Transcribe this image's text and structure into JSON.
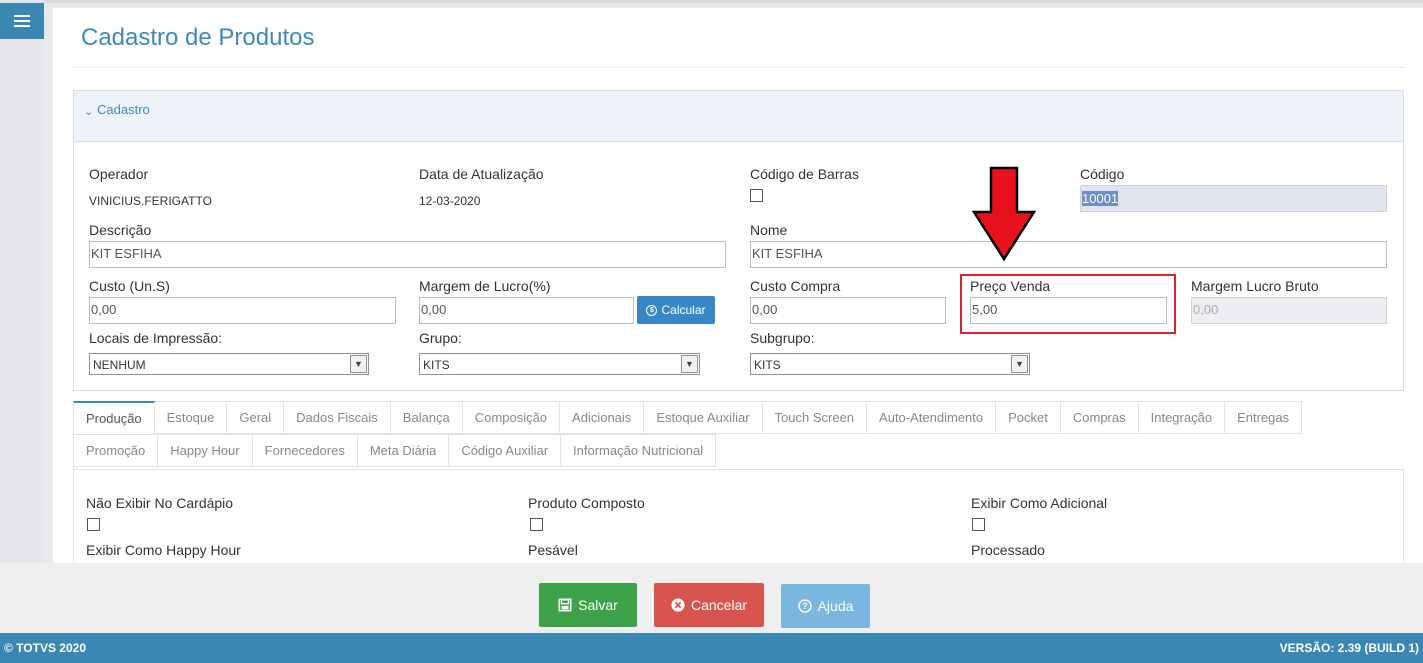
{
  "page_title": "Cadastro de Produtos",
  "panel": {
    "title": "Cadastro"
  },
  "fields": {
    "operador": {
      "label": "Operador",
      "value": "VINICIUS.FERIGATTO"
    },
    "data_atualizacao": {
      "label": "Data de Atualização",
      "value": "12-03-2020"
    },
    "codigo_barras": {
      "label": "Código de Barras",
      "checked": false
    },
    "codigo": {
      "label": "Código",
      "value": "10001"
    },
    "descricao": {
      "label": "Descrição",
      "value": "KIT ESFIHA"
    },
    "nome": {
      "label": "Nome",
      "value": "KIT ESFIHA"
    },
    "custo_un": {
      "label": "Custo (Un.S)",
      "value": "0,00"
    },
    "margem_lucro": {
      "label": "Margem de Lucro(%)",
      "value": "0,00"
    },
    "custo_compra": {
      "label": "Custo Compra",
      "value": "0,00"
    },
    "preco_venda": {
      "label": "Preço Venda",
      "value": "5,00"
    },
    "margem_lucro_bruto": {
      "label": "Margem Lucro Bruto",
      "value": "0,00"
    },
    "locais_impressao": {
      "label": "Locais de Impressão:",
      "selected": "NENHUM"
    },
    "grupo": {
      "label": "Grupo:",
      "selected": "KITS"
    },
    "subgrupo": {
      "label": "Subgrupo:",
      "selected": "KITS"
    }
  },
  "calc_button": {
    "label": "Calcular",
    "icon": "dollar-icon"
  },
  "tabs_row1": [
    "Produção",
    "Estoque",
    "Geral",
    "Dados Fiscais",
    "Balança",
    "Composição",
    "Adicionais",
    "Estoque Auxiliar",
    "Touch Screen",
    "Auto-Atendimento",
    "Pocket",
    "Compras",
    "Integração",
    "Entregas"
  ],
  "tabs_row2": [
    "Promoção",
    "Happy Hour",
    "Fornecedores",
    "Meta Diária",
    "Código Auxiliar",
    "Informação Nutricional"
  ],
  "active_tab": "Produção",
  "producao": {
    "nao_exibir_cardapio": {
      "label": "Não Exibir No Cardápio",
      "checked": false
    },
    "produto_composto": {
      "label": "Produto Composto",
      "checked": false
    },
    "exibir_adicional": {
      "label": "Exibir Como Adicional",
      "checked": false
    },
    "exibir_happy_hour": {
      "label": "Exibir Como Happy Hour"
    },
    "pesavel": {
      "label": "Pesável"
    },
    "processado": {
      "label": "Processado"
    }
  },
  "actions": {
    "save_label": "Salvar",
    "cancel_label": "Cancelar",
    "help_label": "Ajuda"
  },
  "footer": {
    "copyright": "© TOTVS 2020",
    "version": "VERSÃO: 2.39 (BUILD 1)"
  },
  "colors": {
    "primary": "#3a87b4",
    "title": "#3f89b9",
    "save": "#3da249",
    "cancel": "#d9534f",
    "help": "#7ab6e0",
    "annotation": "#d9242c"
  }
}
